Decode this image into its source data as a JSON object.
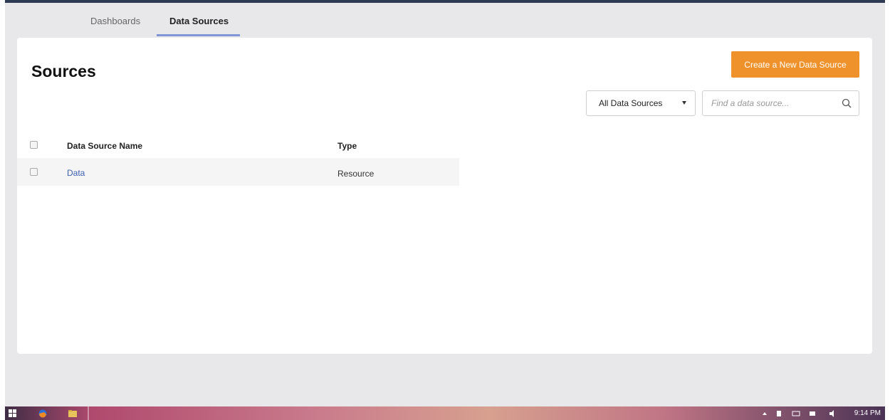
{
  "tabs": [
    {
      "label": "Dashboards",
      "active": false
    },
    {
      "label": "Data Sources",
      "active": true
    }
  ],
  "page": {
    "title": "Sources",
    "create_button": "Create a New Data Source"
  },
  "filter": {
    "selected": "All Data Sources"
  },
  "search": {
    "placeholder": "Find a data source..."
  },
  "table": {
    "headers": {
      "name": "Data Source Name",
      "type": "Type"
    },
    "rows": [
      {
        "name": "Data",
        "type": "Resource"
      }
    ]
  },
  "taskbar": {
    "clock": "9:14 PM"
  },
  "colors": {
    "accent": "#f0922b",
    "tab_underline": "#7f95d6",
    "link": "#3b5fb0"
  }
}
